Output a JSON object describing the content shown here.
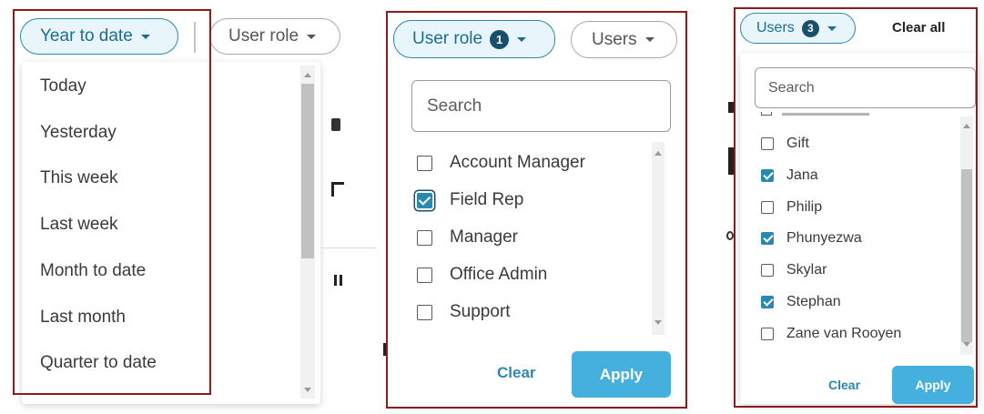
{
  "date_filter": {
    "button_label": "Year to date",
    "options": [
      "Today",
      "Yesterday",
      "This week",
      "Last week",
      "Month to date",
      "Last month",
      "Quarter to date"
    ]
  },
  "role_filter": {
    "button_label": "User role",
    "badge": "1",
    "search_placeholder": "Search",
    "options": [
      {
        "label": "Account Manager",
        "checked": false
      },
      {
        "label": "Field Rep",
        "checked": true
      },
      {
        "label": "Manager",
        "checked": false
      },
      {
        "label": "Office Admin",
        "checked": false
      },
      {
        "label": "Support",
        "checked": false
      }
    ],
    "clear_label": "Clear",
    "apply_label": "Apply"
  },
  "users_filter": {
    "button_label": "Users",
    "badge": "3",
    "clear_all_label": "Clear all",
    "search_placeholder": "Search",
    "options": [
      {
        "label": "Gift",
        "checked": false
      },
      {
        "label": "Jana",
        "checked": true
      },
      {
        "label": "Philip",
        "checked": false
      },
      {
        "label": "Phunyezwa",
        "checked": true
      },
      {
        "label": "Skylar",
        "checked": false
      },
      {
        "label": "Stephan",
        "checked": true
      },
      {
        "label": "Zane van Rooyen",
        "checked": false
      }
    ],
    "clear_label": "Clear",
    "apply_label": "Apply"
  },
  "colors": {
    "accent": "#2b88b0",
    "apply": "#45b0de",
    "badge": "#18506b",
    "highlight_frame": "#8b1c1c"
  }
}
